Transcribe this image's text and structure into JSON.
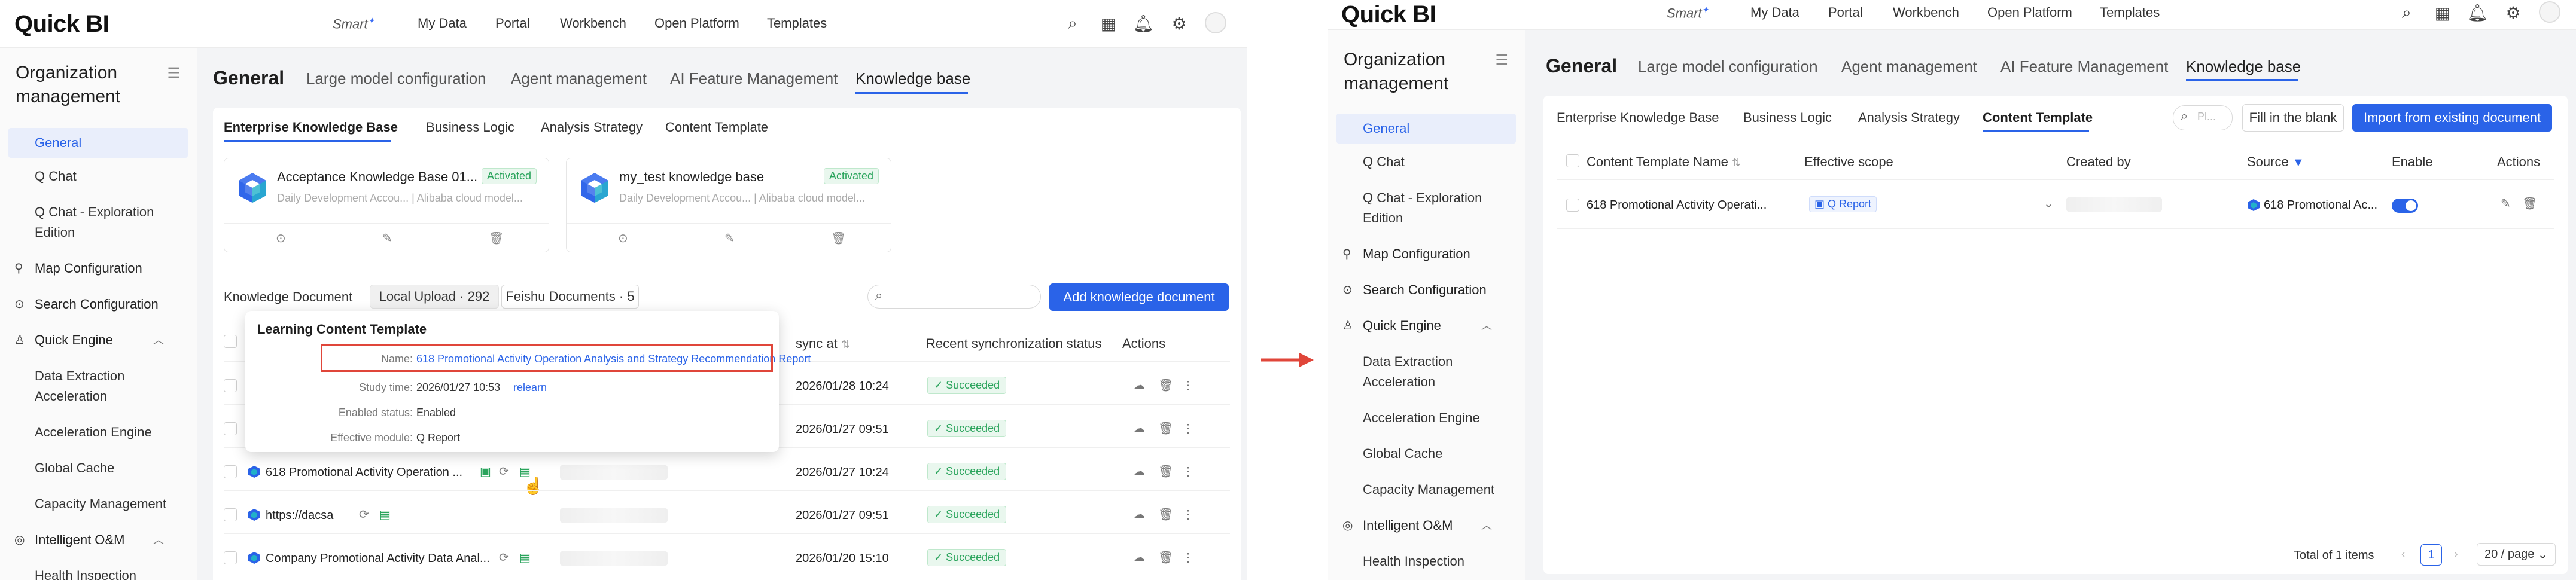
{
  "brand": {
    "logo": "Quick BI",
    "accent": "#2a63e8",
    "success": "#2aa45c",
    "highlight_border": "#e0463a"
  },
  "topnav": {
    "smart": "Smart",
    "items": [
      "My Data",
      "Portal",
      "Workbench",
      "Open Platform",
      "Templates"
    ],
    "icons": [
      "search-icon",
      "apps-grid-icon",
      "bell-icon",
      "gear-icon",
      "avatar"
    ]
  },
  "sidebar": {
    "title": "Organization management",
    "general": "General",
    "q_chat": "Q Chat",
    "q_chat_explore": "Q Chat - Exploration Edition",
    "map_config": "Map Configuration",
    "search_config": "Search Configuration",
    "quick_engine": "Quick Engine",
    "data_extraction": "Data Extraction Acceleration",
    "accel_engine": "Acceleration Engine",
    "global_cache": "Global Cache",
    "capacity": "Capacity Management",
    "intelligent_om": "Intelligent O&M",
    "health": "Health Inspection"
  },
  "header": {
    "title": "General",
    "tabs": [
      "Large model configuration",
      "Agent management",
      "AI Feature Management",
      "Knowledge base"
    ]
  },
  "subtabs": [
    "Enterprise Knowledge Base",
    "Business Logic",
    "Analysis Strategy",
    "Content Template"
  ],
  "left": {
    "kb_cards": [
      {
        "name": "Acceptance Knowledge Base 01...",
        "badge": "Activated",
        "sub": "Daily Development Accou...  |  Alibaba cloud model..."
      },
      {
        "name": "my_test knowledge base",
        "badge": "Activated",
        "sub": "Daily Development Accou...  |  Alibaba cloud model..."
      }
    ],
    "doc_title": "Knowledge Document",
    "local_upload": "Local Upload · 292",
    "feishu": "Feishu Documents · 5",
    "add_button": "Add knowledge document",
    "columns": {
      "sync_at": "sync at",
      "recent_status": "Recent synchronization status",
      "actions": "Actions"
    },
    "rows": [
      {
        "name": "",
        "date": "2026/01/28 10:24",
        "status": "Succeeded"
      },
      {
        "name": "",
        "date": "2026/01/27 09:51",
        "status": "Succeeded"
      },
      {
        "name": "618 Promotional Activity Operation ...",
        "date": "2026/01/27 10:24",
        "status": "Succeeded"
      },
      {
        "name": "https://dacsa",
        "date": "2026/01/27 09:51",
        "status": "Succeeded"
      },
      {
        "name": "Company Promotional Activity Data Anal...",
        "date": "2026/01/20 15:10",
        "status": "Succeeded"
      }
    ],
    "popover": {
      "title": "Learning Content Template",
      "name_label": "Name:",
      "name_value": "618 Promotional Activity Operation Analysis and Strategy Recommendation Report",
      "study_label": "Study time:",
      "study_value": "2026/01/27 10:53",
      "relearn": "relearn",
      "enabled_label": "Enabled status:",
      "enabled_value": "Enabled",
      "module_label": "Effective module:",
      "module_value": "Q Report"
    }
  },
  "right": {
    "search_placeholder": "Pl...",
    "fill_blank": "Fill in the blank",
    "import_button": "Import from existing document",
    "columns": [
      "Content Template Name",
      "Effective scope",
      "Created by",
      "Source",
      "Enable",
      "Actions"
    ],
    "row": {
      "name": "618 Promotional Activity Operati...",
      "scope": "Q Report",
      "source": "618 Promotional Ac..."
    },
    "pager": {
      "total": "Total of 1 items",
      "page": "1",
      "size": "20 / page"
    }
  }
}
